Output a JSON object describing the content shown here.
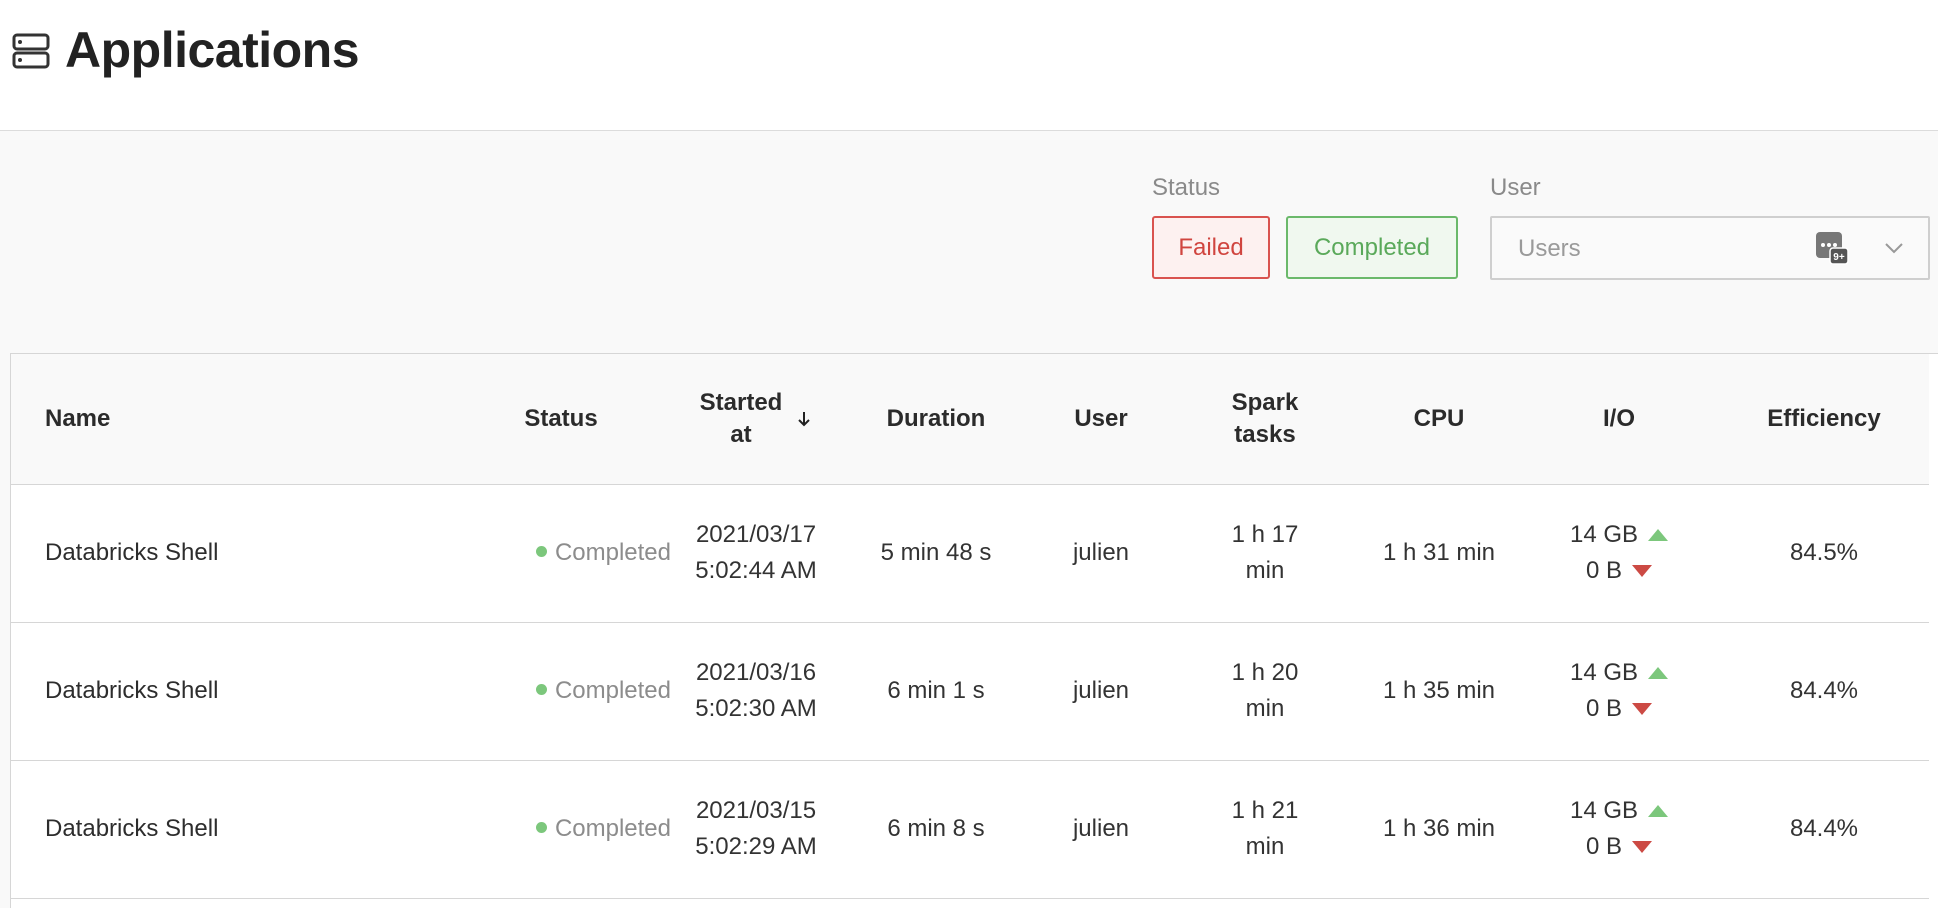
{
  "header": {
    "title": "Applications",
    "icon": "server-icon"
  },
  "filters": {
    "status_label": "Status",
    "failed_label": "Failed",
    "completed_label": "Completed",
    "user_label": "User",
    "user_placeholder": "Users",
    "colors": {
      "failed": "#d0453f",
      "completed": "#5aa95a"
    }
  },
  "table": {
    "columns": {
      "name": "Name",
      "status": "Status",
      "started_line1": "Started",
      "started_line2": "at",
      "duration": "Duration",
      "user": "User",
      "spark_line1": "Spark",
      "spark_line2": "tasks",
      "cpu": "CPU",
      "io": "I/O",
      "efficiency": "Efficiency"
    },
    "sort": {
      "column": "Started at",
      "direction": "descending"
    },
    "rows": [
      {
        "name": "Databricks Shell",
        "status": "Completed",
        "date": "2021/03/17",
        "time": "5:02:44 AM",
        "duration": "5 min 48 s",
        "user": "julien",
        "spark_line1": "1 h 17",
        "spark_line2": "min",
        "cpu": "1 h 31 min",
        "io_in": "14 GB",
        "io_out": "0 B",
        "efficiency": "84.5%"
      },
      {
        "name": "Databricks Shell",
        "status": "Completed",
        "date": "2021/03/16",
        "time": "5:02:30 AM",
        "duration": "6 min 1 s",
        "user": "julien",
        "spark_line1": "1 h 20",
        "spark_line2": "min",
        "cpu": "1 h 35 min",
        "io_in": "14 GB",
        "io_out": "0 B",
        "efficiency": "84.4%"
      },
      {
        "name": "Databricks Shell",
        "status": "Completed",
        "date": "2021/03/15",
        "time": "5:02:29 AM",
        "duration": "6 min 8 s",
        "user": "julien",
        "spark_line1": "1 h 21",
        "spark_line2": "min",
        "cpu": "1 h 36 min",
        "io_in": "14 GB",
        "io_out": "0 B",
        "efficiency": "84.4%"
      }
    ]
  }
}
